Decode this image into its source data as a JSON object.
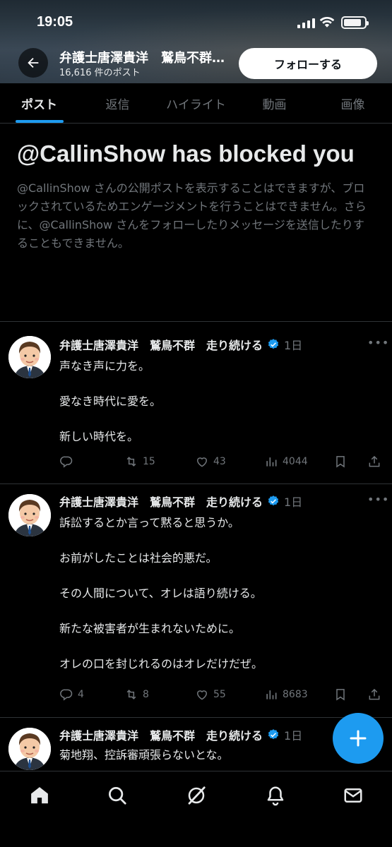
{
  "status_bar": {
    "time": "19:05",
    "battery_level": 0.85
  },
  "header": {
    "title": "弁護士唐澤貴洋　鷲鳥不群　走り続ける",
    "post_count": "16,616 件のポスト",
    "follow_label": "フォローする"
  },
  "tabs": [
    {
      "label": "ポスト",
      "active": true
    },
    {
      "label": "返信",
      "active": false
    },
    {
      "label": "ハイライト",
      "active": false
    },
    {
      "label": "動画",
      "active": false
    },
    {
      "label": "画像",
      "active": false
    }
  ],
  "blocked": {
    "title": "@CallinShow has blocked you",
    "message": "@CallinShow さんの公開ポストを表示することはできますが、ブロックされているためエンゲージメントを行うことはできません。さらに、@CallinShow さんをフォローしたりメッセージを送信したりすることもできません。"
  },
  "posts": [
    {
      "author": "弁護士唐澤貴洋　鷲鳥不群　走り続ける",
      "time": "1日",
      "lines": [
        "声なき声に力を。",
        "愛なき時代に愛を。",
        "新しい時代を。"
      ],
      "replies": "",
      "reposts": "15",
      "likes": "43",
      "views": "4044"
    },
    {
      "author": "弁護士唐澤貴洋　鷲鳥不群　走り続ける",
      "time": "1日",
      "lines": [
        "訴訟するとか言って黙ると思うか。",
        "お前がしたことは社会的悪だ。",
        "その人間について、オレは語り続ける。",
        "新たな被害者が生まれないために。",
        "オレの口を封じれるのはオレだけだぜ。"
      ],
      "replies": "4",
      "reposts": "8",
      "likes": "55",
      "views": "8683"
    },
    {
      "author": "弁護士唐澤貴洋　鷲鳥不群　走り続ける",
      "time": "1日",
      "lines": [
        "菊地翔、控訴審頑張らないとな。"
      ]
    }
  ],
  "colors": {
    "accent": "#1d9bf0",
    "muted": "#71767b",
    "text": "#e7e9ea",
    "divider": "#2f3336"
  }
}
